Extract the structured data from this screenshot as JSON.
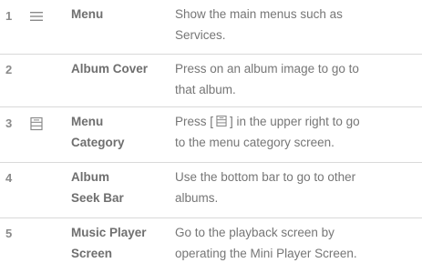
{
  "rows": [
    {
      "number": "1",
      "icon": "hamburger-menu-icon",
      "label_line1": "Menu",
      "label_line2": "",
      "desc_line1": "Show the main menus such as",
      "desc_line2": "Services."
    },
    {
      "number": "2",
      "icon": "",
      "label_line1": "Album Cover",
      "label_line2": "",
      "desc_line1": "Press on an album image to go to",
      "desc_line2": "that album."
    },
    {
      "number": "3",
      "icon": "menu-category-icon",
      "label_line1": "Menu",
      "label_line2": "Category",
      "desc_line1_before": "Press [",
      "desc_line1_after": "] in the upper right to go",
      "desc_line2": "to the menu category screen."
    },
    {
      "number": "4",
      "icon": "",
      "label_line1": "Album",
      "label_line2": "Seek Bar",
      "desc_line1": "Use the bottom bar to go to other",
      "desc_line2": "albums."
    },
    {
      "number": "5",
      "icon": "",
      "label_line1": "Music Player",
      "label_line2": "Screen",
      "desc_line1": "Go to the playback screen by",
      "desc_line2": "operating the Mini Player Screen."
    }
  ],
  "colors": {
    "text": "#6f6f6f",
    "rule": "#d9d9d9"
  }
}
